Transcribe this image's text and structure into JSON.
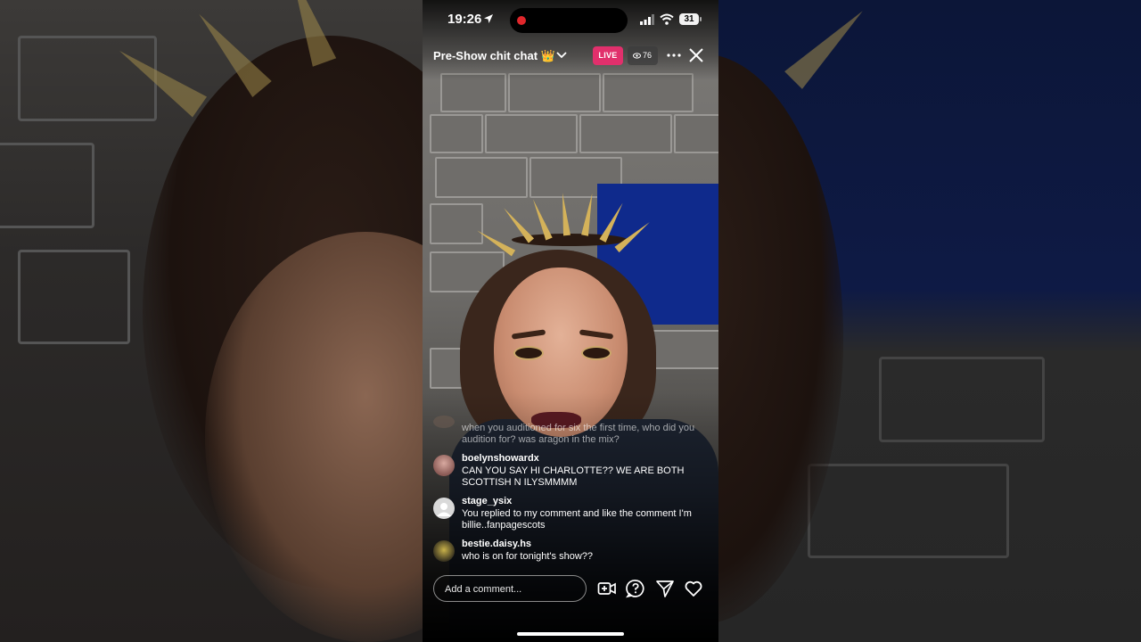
{
  "status_bar": {
    "time": "19:26",
    "battery": "31"
  },
  "live_header": {
    "title": "Pre-Show chit chat 👑",
    "live_badge": "LIVE",
    "viewer_count": "76"
  },
  "comments": [
    {
      "username": "",
      "text": "when you auditioned for six the first time, who did you audition for? was aragon in the mix?"
    },
    {
      "username": "boelynshowardx",
      "text": "CAN YOU SAY HI CHARLOTTE?? WE ARE BOTH SCOTTISH N ILYSMMMM"
    },
    {
      "username": "stage_ysix",
      "text": "You replied to my comment and like the comment I'm  billie..fanpagescots"
    },
    {
      "username": "bestie.daisy.hs",
      "text": "who is on for tonight's show??"
    }
  ],
  "comment_input": {
    "placeholder": "Add a comment..."
  },
  "icons": {
    "add_guest": "add-video-icon",
    "question": "question-icon",
    "share": "send-icon",
    "like": "heart-icon",
    "more": "more-icon",
    "close": "close-icon"
  },
  "colors": {
    "live_badge": "#e1306c",
    "background": "#000000"
  }
}
